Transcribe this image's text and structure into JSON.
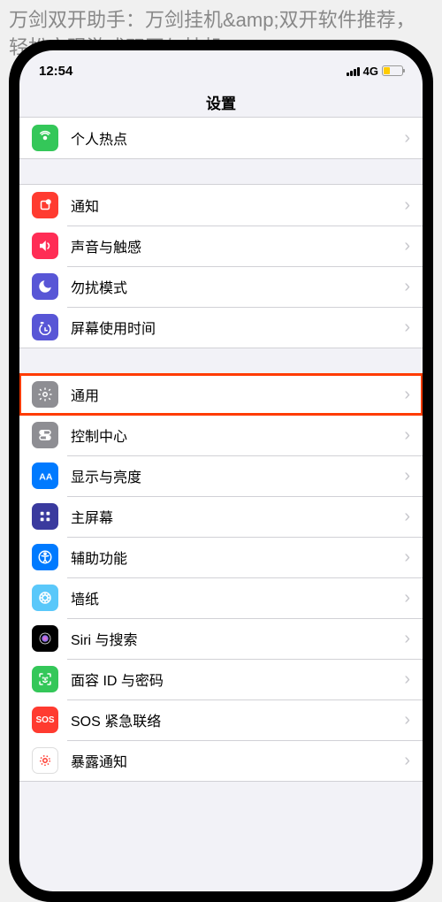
{
  "article": {
    "title": "万剑双开助手：万剑挂机&amp;双开软件推荐，轻松实现游戏双开与挂机"
  },
  "status": {
    "time": "12:54",
    "network": "4G"
  },
  "nav": {
    "title": "设置"
  },
  "rows": {
    "hotspot": "个人热点",
    "notifications": "通知",
    "sounds": "声音与触感",
    "dnd": "勿扰模式",
    "screentime": "屏幕使用时间",
    "general": "通用",
    "control": "控制中心",
    "display": "显示与亮度",
    "home": "主屏幕",
    "accessibility": "辅助功能",
    "wallpaper": "墙纸",
    "siri": "Siri 与搜索",
    "faceid": "面容 ID 与密码",
    "sos": "SOS 紧急联络",
    "sos_label": "SOS",
    "exposure": "暴露通知"
  }
}
